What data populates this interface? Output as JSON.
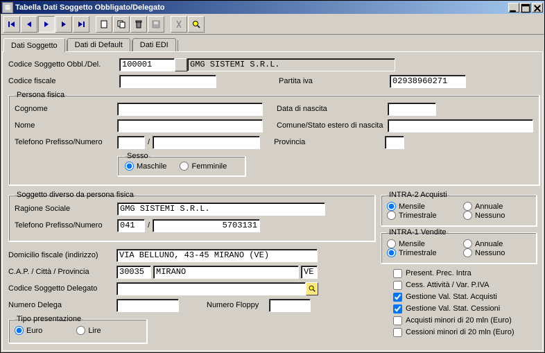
{
  "window": {
    "title": "Tabella Dati Soggetto Obbligato/Delegato"
  },
  "winbtns": {
    "min": "_",
    "restore": "❐",
    "close": "✕"
  },
  "tabs": {
    "t1": "Dati Soggetto",
    "t2": "Dati di Default",
    "t3": "Dati EDI"
  },
  "labels": {
    "codice_sogg": "Codice Soggetto Obbl./Del.",
    "codice_fiscale": "Codice fiscale",
    "partita_iva": "Partita iva",
    "persona_fisica": "Persona fisica",
    "cognome": "Cognome",
    "nome": "Nome",
    "telefono": "Telefono Prefisso/Numero",
    "data_nascita": "Data di nascita",
    "comune_stato": "Comune/Stato estero di nascita",
    "provincia": "Provincia",
    "sesso": "Sesso",
    "maschile": "Maschile",
    "femminile": "Femminile",
    "soggetto_diverso": "Soggetto diverso da persona fisica",
    "ragione_sociale": "Ragione Sociale",
    "domicilio": "Domicilio fiscale (indirizzo)",
    "cap_citta": "C.A.P. / Città / Provincia",
    "codice_delegato": "Codice Soggetto Delegato",
    "numero_delega": "Numero Delega",
    "numero_floppy": "Numero Floppy",
    "tipo_pres": "Tipo presentazione",
    "euro": "Euro",
    "lire": "Lire",
    "slash": "/",
    "intra2": "INTRA-2 Acquisti",
    "intra1": "INTRA-1 Vendite",
    "mensile": "Mensile",
    "annuale": "Annuale",
    "trimestrale": "Trimestrale",
    "nessuno": "Nessuno",
    "present_prec": "Present. Prec. Intra",
    "cess_attivita": "Cess. Attività / Var. P.IVA",
    "gest_acq": "Gestione Val. Stat. Acquisti",
    "gest_cess": "Gestione Val. Stat. Cessioni",
    "acq_min": "Acquisti minori di 20 mln (Euro)",
    "cess_min": "Cessioni minori di 20 mln (Euro)"
  },
  "values": {
    "codice_sogg": "100001",
    "company_name": "GMG SISTEMI S.R.L.",
    "codice_fiscale": "",
    "partita_iva": "02938960271",
    "cognome": "",
    "nome": "",
    "tel_pref_pf": "",
    "tel_num_pf": "",
    "data_nascita": "",
    "comune_stato": "",
    "provincia": "",
    "ragione_sociale": "GMG SISTEMI S.R.L.",
    "tel_pref": "041",
    "tel_num": "5703131",
    "domicilio": "VIA BELLUNO, 43-45 MIRANO (VE)",
    "cap": "30035",
    "citta": "MIRANO",
    "prov": "VE",
    "codice_delegato": "",
    "numero_delega": "",
    "numero_floppy": ""
  },
  "radios": {
    "sesso": "M",
    "intra2": "Mensile",
    "intra1": "Trimestrale",
    "tipo_pres": "Euro"
  },
  "checks": {
    "present_prec": false,
    "cess_attivita": false,
    "gest_acq": true,
    "gest_cess": true,
    "acq_min": false,
    "cess_min": false
  }
}
